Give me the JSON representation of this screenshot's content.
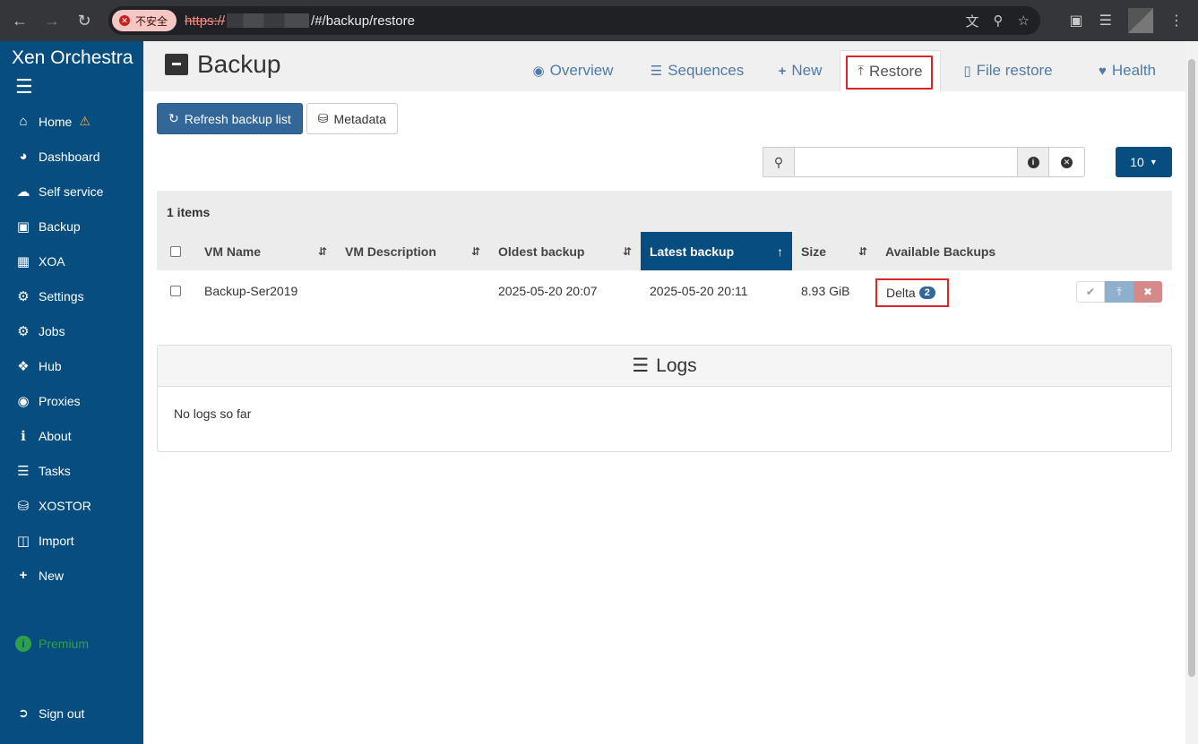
{
  "browser": {
    "security_label": "不安全",
    "url_scheme": "https://",
    "url_path": "/#/backup/restore"
  },
  "sidebar": {
    "brand": "Xen Orchestra",
    "items": [
      {
        "label": "Home",
        "icon": "home-icon"
      },
      {
        "label": "Dashboard",
        "icon": "dashboard-icon"
      },
      {
        "label": "Self service",
        "icon": "cloud-icon"
      },
      {
        "label": "Backup",
        "icon": "archive-icon"
      },
      {
        "label": "XOA",
        "icon": "cube-icon"
      },
      {
        "label": "Settings",
        "icon": "gear-icon"
      },
      {
        "label": "Jobs",
        "icon": "gears-icon"
      },
      {
        "label": "Hub",
        "icon": "cubes-icon"
      },
      {
        "label": "Proxies",
        "icon": "globe-icon"
      },
      {
        "label": "About",
        "icon": "info-icon"
      },
      {
        "label": "Tasks",
        "icon": "tasks-icon"
      },
      {
        "label": "XOSTOR",
        "icon": "database-icon"
      },
      {
        "label": "Import",
        "icon": "file-import-icon"
      },
      {
        "label": "New",
        "icon": "plus-icon"
      }
    ],
    "premium": "Premium",
    "sign_out": "Sign out"
  },
  "header": {
    "title": "Backup",
    "tabs": [
      {
        "label": "Overview"
      },
      {
        "label": "Sequences"
      },
      {
        "label": "New"
      },
      {
        "label": "Restore",
        "active": true
      },
      {
        "label": "File restore"
      },
      {
        "label": "Health"
      }
    ]
  },
  "toolbar": {
    "refresh_label": "Refresh backup list",
    "metadata_label": "Metadata",
    "per_page": "10"
  },
  "table": {
    "items_count": "1 items",
    "columns": [
      "VM Name",
      "VM Description",
      "Oldest backup",
      "Latest backup",
      "Size",
      "Available Backups"
    ],
    "rows": [
      {
        "vm_name": "Backup-Ser2019",
        "vm_description": "",
        "oldest": "2025-05-20 20:07",
        "latest": "2025-05-20 20:11",
        "size": "8.93 GiB",
        "backup_type": "Delta",
        "backup_count": "2"
      }
    ]
  },
  "logs": {
    "title": "Logs",
    "empty": "No logs so far"
  },
  "colors": {
    "sidebar_bg": "#074d80",
    "primary": "#336699",
    "highlight_box": "#d9262b",
    "premium_green": "#2ea049"
  }
}
